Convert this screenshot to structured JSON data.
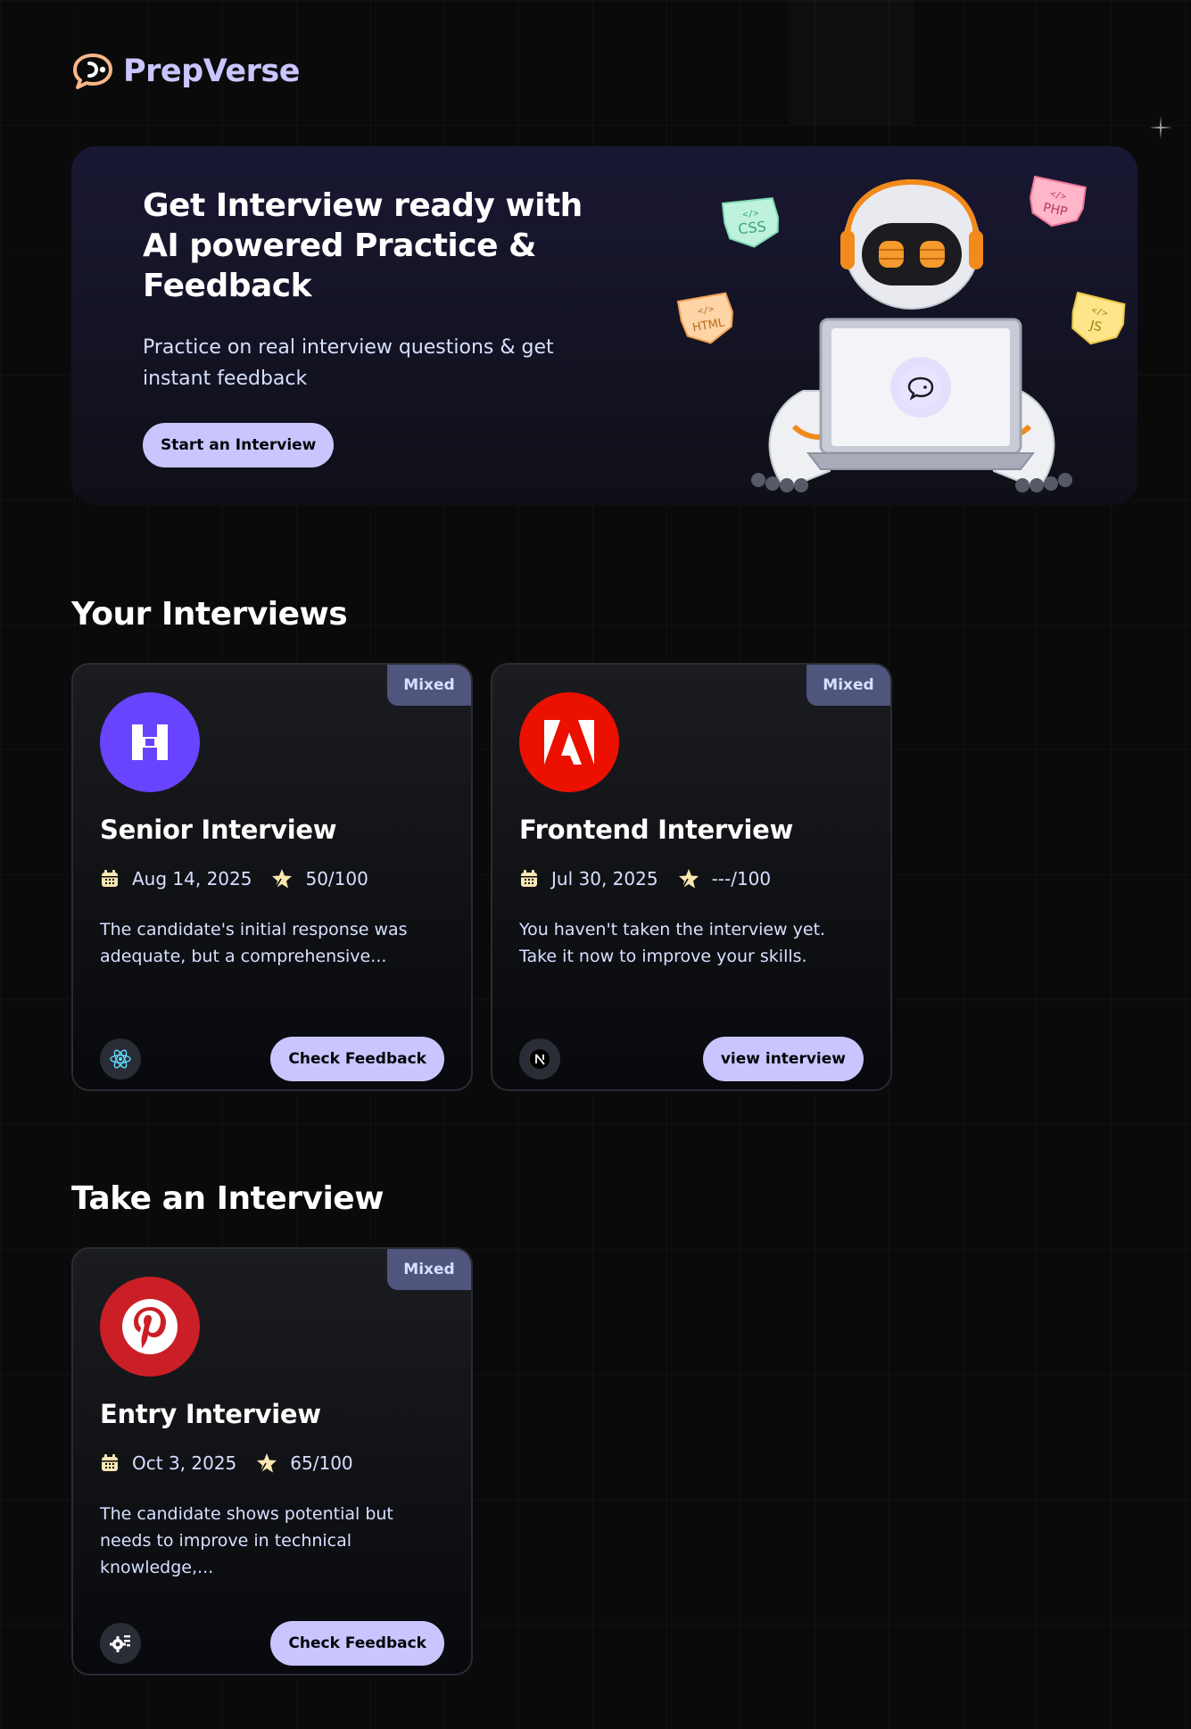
{
  "app": {
    "name": "PrepVerse"
  },
  "hero": {
    "title": "Get Interview ready with AI powered Practice & Feedback",
    "subtitle": "Practice on real interview questions & get instant feedback",
    "cta_label": "Start an Interview",
    "tags": [
      "CSS",
      "PHP",
      "HTML",
      "JS"
    ]
  },
  "sections": {
    "your_interviews": "Your Interviews",
    "take_interview": "Take an Interview"
  },
  "your_interviews": [
    {
      "badge": "Mixed",
      "logo": "hashnode-logo",
      "logo_color": "#6944ff",
      "title": "Senior Interview",
      "date": "Aug 14, 2025",
      "score": "50/100",
      "description": "The candidate's initial response was adequate, but a comprehensive...",
      "tech_icon": "react-icon",
      "action_label": "Check Feedback"
    },
    {
      "badge": "Mixed",
      "logo": "adobe-logo",
      "logo_color": "#eb1000",
      "title": "Frontend Interview",
      "date": "Jul 30, 2025",
      "score": "---/100",
      "description": "You haven't taken the interview yet. Take it now to improve your skills.",
      "tech_icon": "nextjs-icon",
      "action_label": "view interview"
    }
  ],
  "take_interviews": [
    {
      "badge": "Mixed",
      "logo": "pinterest-logo",
      "logo_color": "#cb1f27",
      "title": "Entry Interview",
      "date": "Oct 3, 2025",
      "score": "65/100",
      "description": "The candidate shows potential but needs to improve in technical knowledge,...",
      "tech_icon": "gear-icon",
      "action_label": "Check Feedback"
    }
  ],
  "colors": {
    "background": "#0a0a0b",
    "accent": "#cac5fe",
    "badge": "#4f557d",
    "text_light": "#d6e0ff",
    "star": "#fae6b1"
  }
}
